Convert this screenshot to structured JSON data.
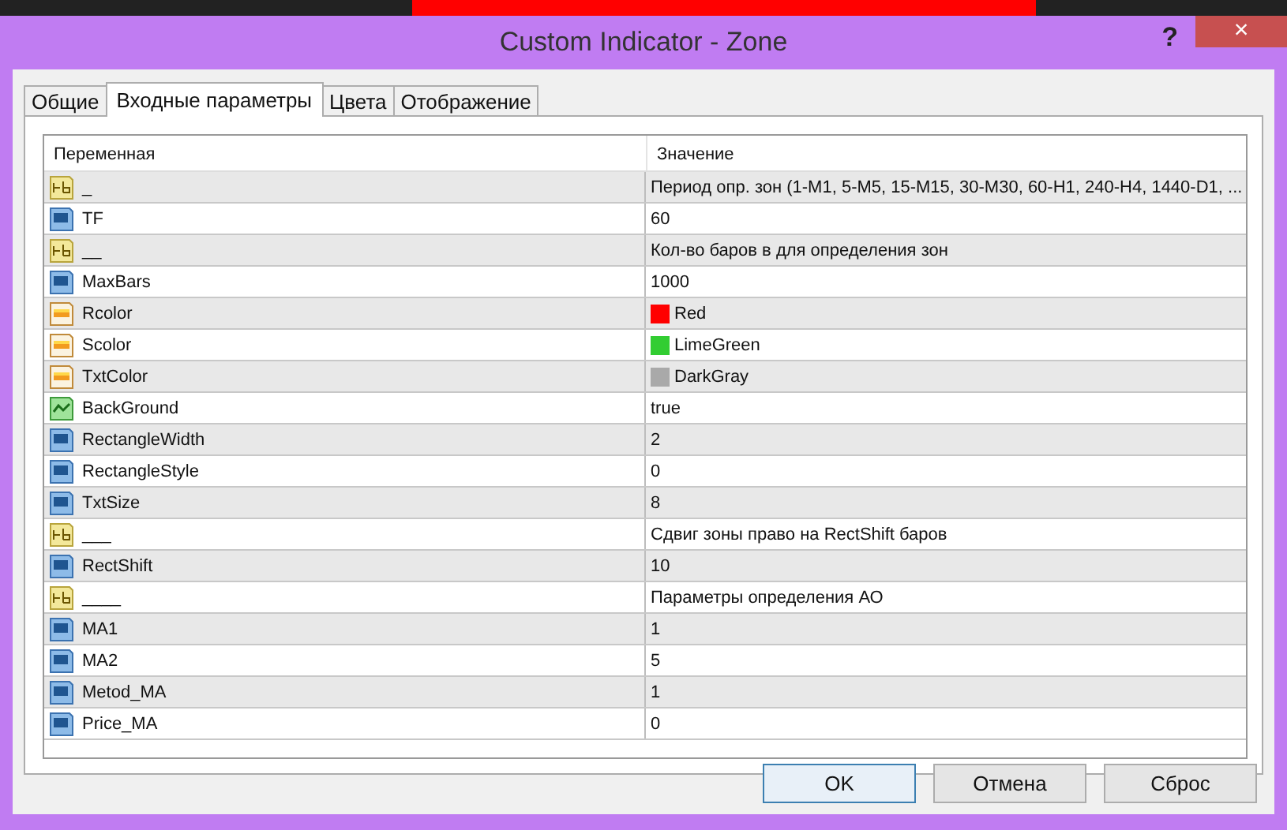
{
  "window": {
    "title": "Custom Indicator - Zone",
    "help": "?",
    "close": "×"
  },
  "tabs": [
    {
      "label": "Общие",
      "selected": false
    },
    {
      "label": "Входные параметры",
      "selected": true
    },
    {
      "label": "Цвета",
      "selected": false
    },
    {
      "label": "Отображение",
      "selected": false
    }
  ],
  "table": {
    "columns": [
      "Переменная",
      "Значение"
    ],
    "rows": [
      {
        "kind": "string",
        "name": "_",
        "value": "Период опр. зон (1-M1, 5-M5, 15-M15, 30-M30, 60-H1, 240-H4, 1440-D1, ..."
      },
      {
        "kind": "int",
        "name": "TF",
        "value": "60"
      },
      {
        "kind": "string",
        "name": "__",
        "value": "Кол-во баров в для определения зон"
      },
      {
        "kind": "int",
        "name": "MaxBars",
        "value": "1000"
      },
      {
        "kind": "color",
        "name": "Rcolor",
        "value": "Red",
        "color": "#ff0000"
      },
      {
        "kind": "color",
        "name": "Scolor",
        "value": "LimeGreen",
        "color": "#32cd32"
      },
      {
        "kind": "color",
        "name": "TxtColor",
        "value": "DarkGray",
        "color": "#a9a9a9"
      },
      {
        "kind": "bool",
        "name": "BackGround",
        "value": "true"
      },
      {
        "kind": "int",
        "name": "RectangleWidth",
        "value": "2"
      },
      {
        "kind": "int",
        "name": "RectangleStyle",
        "value": "0"
      },
      {
        "kind": "int",
        "name": "TxtSize",
        "value": "8"
      },
      {
        "kind": "string",
        "name": "___",
        "value": "Сдвиг зоны право на RectShift баров"
      },
      {
        "kind": "int",
        "name": "RectShift",
        "value": "10"
      },
      {
        "kind": "string",
        "name": "____",
        "value": "Параметры определения АО"
      },
      {
        "kind": "int",
        "name": "MA1",
        "value": "1"
      },
      {
        "kind": "int",
        "name": "MA2",
        "value": "5"
      },
      {
        "kind": "int",
        "name": "Metod_MA",
        "value": "1"
      },
      {
        "kind": "int",
        "name": "Price_MA",
        "value": "0"
      }
    ]
  },
  "buttons": [
    {
      "label": "OK",
      "selected": true
    },
    {
      "label": "Отмена",
      "selected": false
    },
    {
      "label": "Сброс",
      "selected": false
    }
  ]
}
